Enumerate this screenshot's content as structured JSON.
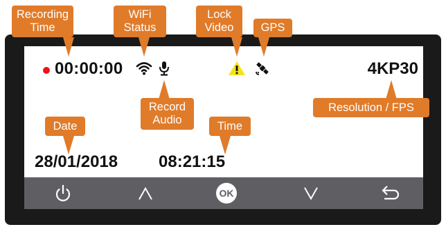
{
  "status_bar": {
    "recording_time": "00:00:00",
    "resolution_fps": "4KP30",
    "icons": [
      "recording-dot",
      "wifi-icon",
      "microphone-icon",
      "lock-warning-icon",
      "gps-satellite-icon"
    ],
    "recording_dot_color": "#e8141b"
  },
  "datetime": {
    "date": "28/01/2018",
    "time": "08:21:15"
  },
  "toolbar": {
    "buttons": [
      "power-icon",
      "up-icon",
      "ok-button",
      "down-icon",
      "back-icon"
    ],
    "ok_label": "OK"
  },
  "callouts": {
    "recording_time": [
      "Recording",
      "Time"
    ],
    "wifi_status": [
      "WiFi",
      "Status"
    ],
    "lock_video": [
      "Lock",
      "Video"
    ],
    "gps": [
      "GPS"
    ],
    "record_audio": [
      "Record",
      "Audio"
    ],
    "resolution_fps": [
      "Resolution / FPS"
    ],
    "date": [
      "Date"
    ],
    "time": [
      "Time"
    ]
  },
  "colors": {
    "callout": "#e07b2a",
    "frame": "#1a1a1a",
    "toolbar": "#5f5f63",
    "warning": "#f5e31a"
  }
}
